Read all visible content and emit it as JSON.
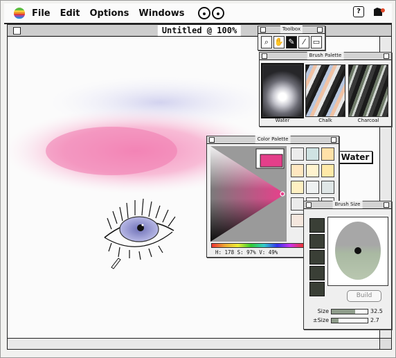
{
  "menubar": {
    "items": [
      "File",
      "Edit",
      "Options",
      "Windows"
    ],
    "help_icon_text": "?"
  },
  "document": {
    "title": "Untitled @ 100%"
  },
  "toolbox": {
    "title": "Toolbox",
    "tools": [
      "magnifier-icon",
      "hand-icon",
      "brush-icon",
      "eyedropper-icon",
      "selection-icon"
    ],
    "active_tool": "brush-icon"
  },
  "brush_palette": {
    "title": "Brush Palette",
    "brushes": [
      "Water",
      "Chalk",
      "Charcoal"
    ],
    "selected": "Water",
    "current_label": "Water"
  },
  "color_palette": {
    "title": "Color Palette",
    "current_color": "#e43f8a",
    "swatches": [
      "#ececec",
      "#cfe2e2",
      "#ffe1a8",
      "#ffe7c0",
      "#fff3cf",
      "#ffe9a8",
      "#fff0c2",
      "#eef1f1",
      "#dfe6e6",
      "#ececec",
      "#ececec",
      "#ececec",
      "#f5e7de",
      "#eeeeee",
      "#ececec"
    ],
    "readout": "H: 178 S: 97% V: 49%"
  },
  "brush_size": {
    "title": "Brush Size",
    "build_label": "Build",
    "size_label": "Size",
    "size_value": "32.5",
    "size_fraction": 0.65,
    "pm_size_label": "±Size",
    "pm_size_value": "2.7",
    "pm_size_fraction": 0.2
  }
}
